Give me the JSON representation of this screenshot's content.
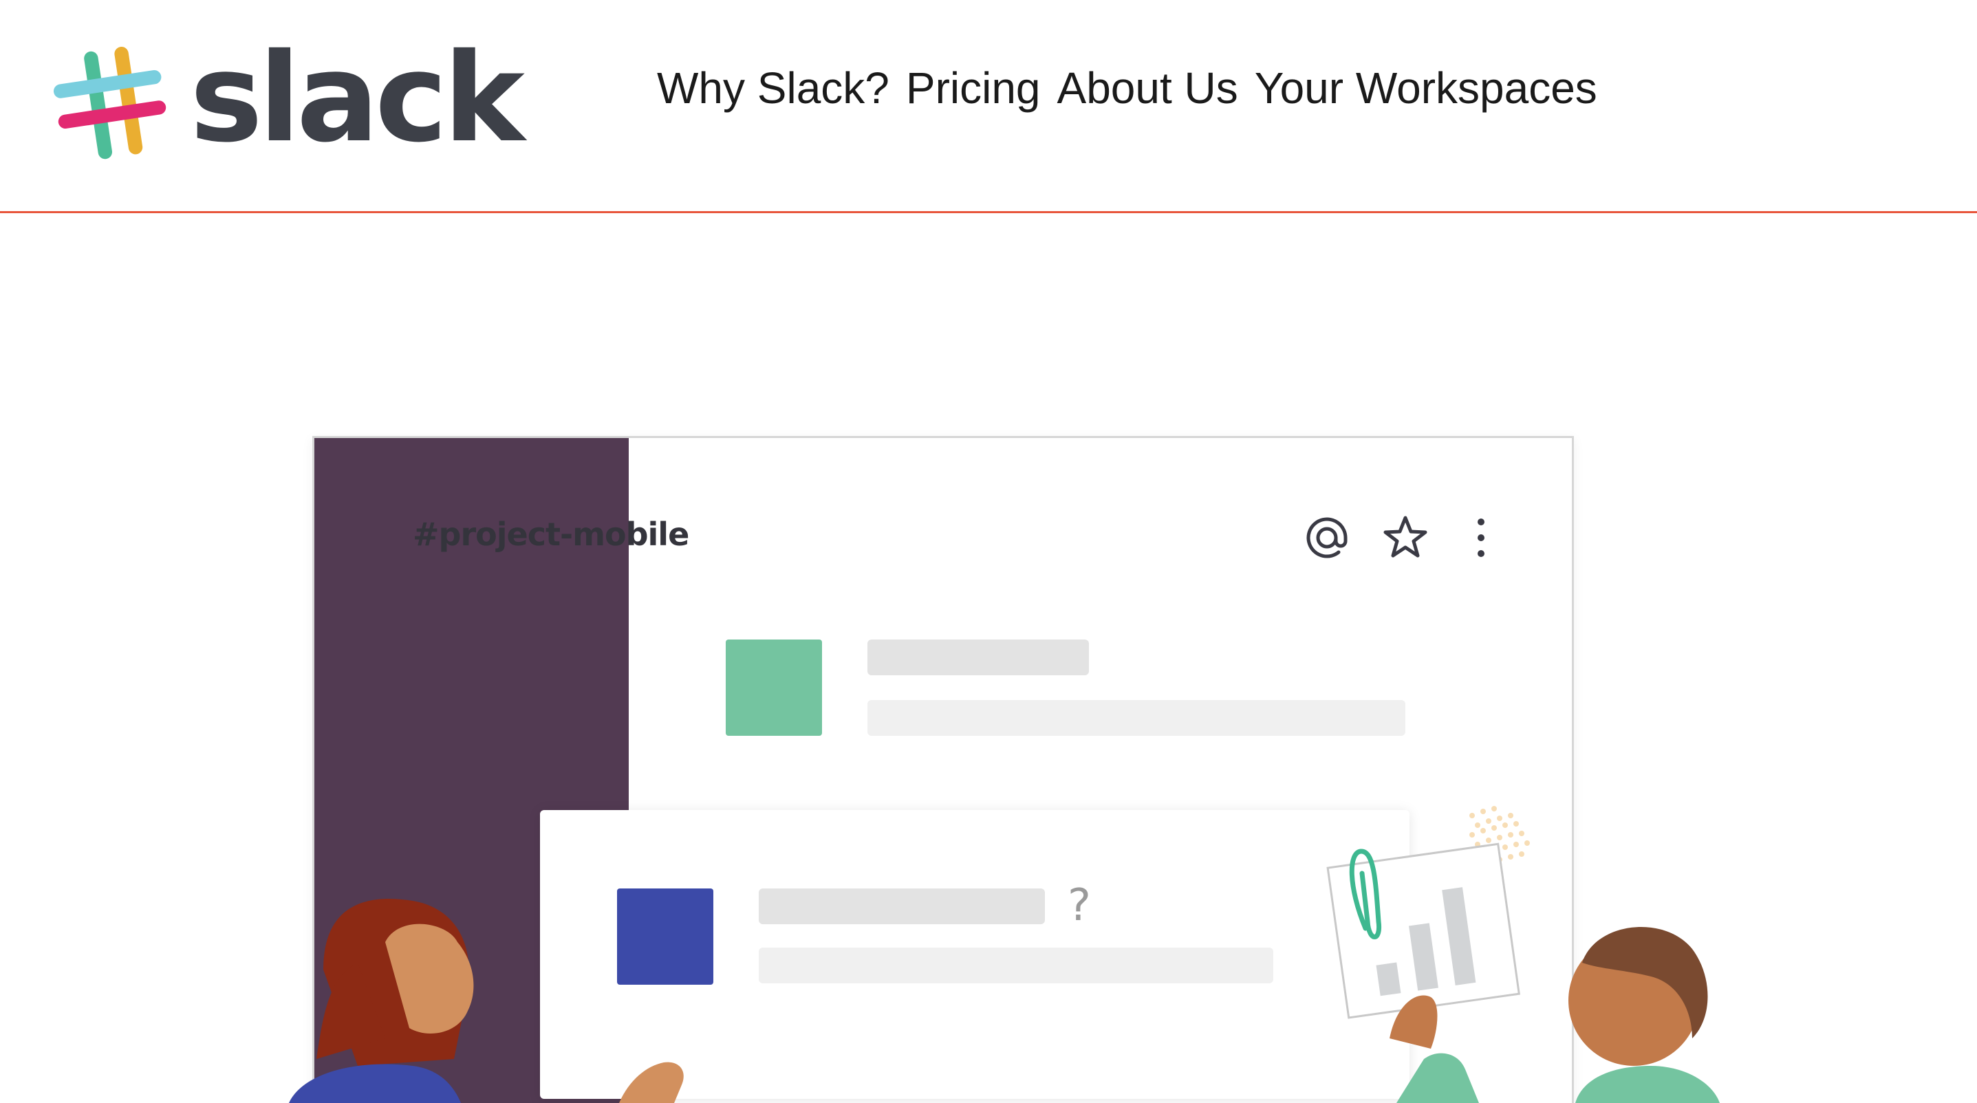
{
  "header": {
    "brand": {
      "wordmark": "slack",
      "logo_icon": "slack-hash-logo-icon",
      "colors": [
        "#6ecadc",
        "#e9a820",
        "#3eb890",
        "#e01765"
      ]
    },
    "nav": {
      "links": [
        {
          "label": "Why Slack?"
        },
        {
          "label": "Pricing"
        },
        {
          "label": "About Us"
        },
        {
          "label": "Your Workspaces"
        }
      ]
    },
    "divider_color": "#e8563c"
  },
  "illustration": {
    "channel_name": "#project-mobile",
    "header_icons": [
      "at-icon",
      "star-icon",
      "more-vertical-icon"
    ],
    "card_question_mark": "?",
    "sidebar_color": "#523a52",
    "avatar_colors": [
      "#74c4a0",
      "#3c4aa8"
    ]
  }
}
